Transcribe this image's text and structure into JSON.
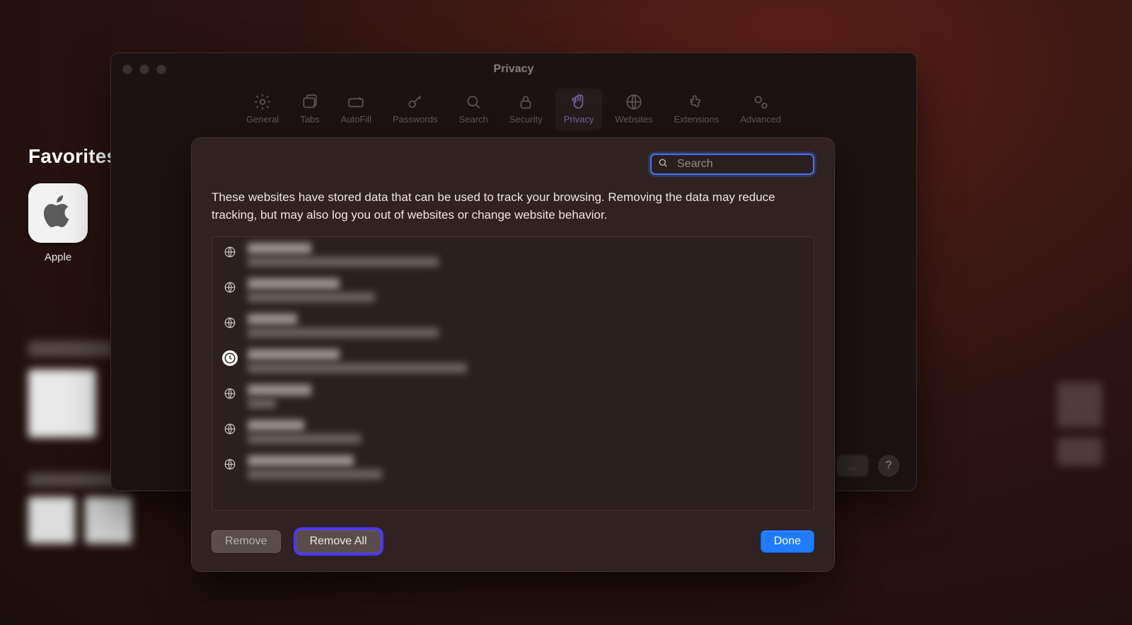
{
  "start_page": {
    "favorites_title": "Favorites",
    "apple_label": "Apple"
  },
  "prefs": {
    "title": "Privacy",
    "tabs": [
      {
        "label": "General"
      },
      {
        "label": "Tabs"
      },
      {
        "label": "AutoFill"
      },
      {
        "label": "Passwords"
      },
      {
        "label": "Search"
      },
      {
        "label": "Security"
      },
      {
        "label": "Privacy"
      },
      {
        "label": "Websites"
      },
      {
        "label": "Extensions"
      },
      {
        "label": "Advanced"
      }
    ],
    "active_tab_index": 6,
    "footer_ellipsis": "…",
    "help_label": "?"
  },
  "sheet": {
    "search_placeholder": "Search",
    "search_value": "",
    "description": "These websites have stored data that can be used to track your browsing. Removing the data may reduce tracking, but may also log you out of websites or change website behavior.",
    "sites": [
      {
        "icon": "globe",
        "title_w": 90,
        "sub_w": 270
      },
      {
        "icon": "globe",
        "title_w": 130,
        "sub_w": 180
      },
      {
        "icon": "globe",
        "title_w": 70,
        "sub_w": 270
      },
      {
        "icon": "clock",
        "title_w": 130,
        "sub_w": 310
      },
      {
        "icon": "globe",
        "title_w": 90,
        "sub_w": 40
      },
      {
        "icon": "globe",
        "title_w": 80,
        "sub_w": 160
      },
      {
        "icon": "globe",
        "title_w": 150,
        "sub_w": 190
      }
    ],
    "buttons": {
      "remove": "Remove",
      "remove_all": "Remove All",
      "done": "Done"
    }
  }
}
